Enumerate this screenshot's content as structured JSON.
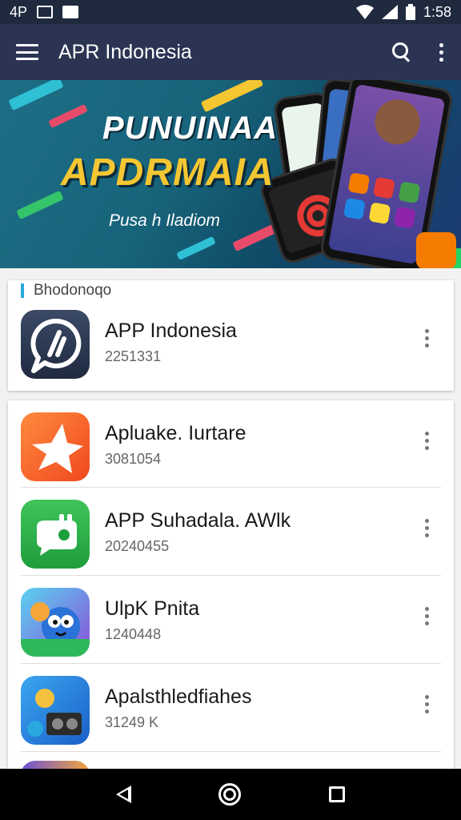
{
  "status_bar": {
    "left_text": "4P",
    "time": "1:58"
  },
  "app_bar": {
    "title": "APR Indonesia"
  },
  "banner": {
    "line1": "PUNUINAA",
    "line2": "APDRMAIA",
    "line3": "Pusa h Iladiom"
  },
  "featured": {
    "section_label": "Bhodonoqo",
    "app": {
      "name": "APP Indonesia",
      "meta": "2251331"
    }
  },
  "apps": [
    {
      "name": "Apluake. Iurtare",
      "meta": "3081054",
      "icon": "star-icon"
    },
    {
      "name": "APP Suhadala. AWlk",
      "meta": "20240455",
      "icon": "chat-bubble-icon"
    },
    {
      "name": "UlpK Pnita",
      "meta": "1240448",
      "icon": "bird-mascot-icon"
    },
    {
      "name": "Apalsthledfiahes",
      "meta": "31249 K",
      "icon": "mascot-radio-icon"
    }
  ],
  "colors": {
    "status_bar": "#1f2a3f",
    "app_bar": "#2b3553",
    "accent": "#29a8e0",
    "banner_yellow": "#f4c631"
  }
}
